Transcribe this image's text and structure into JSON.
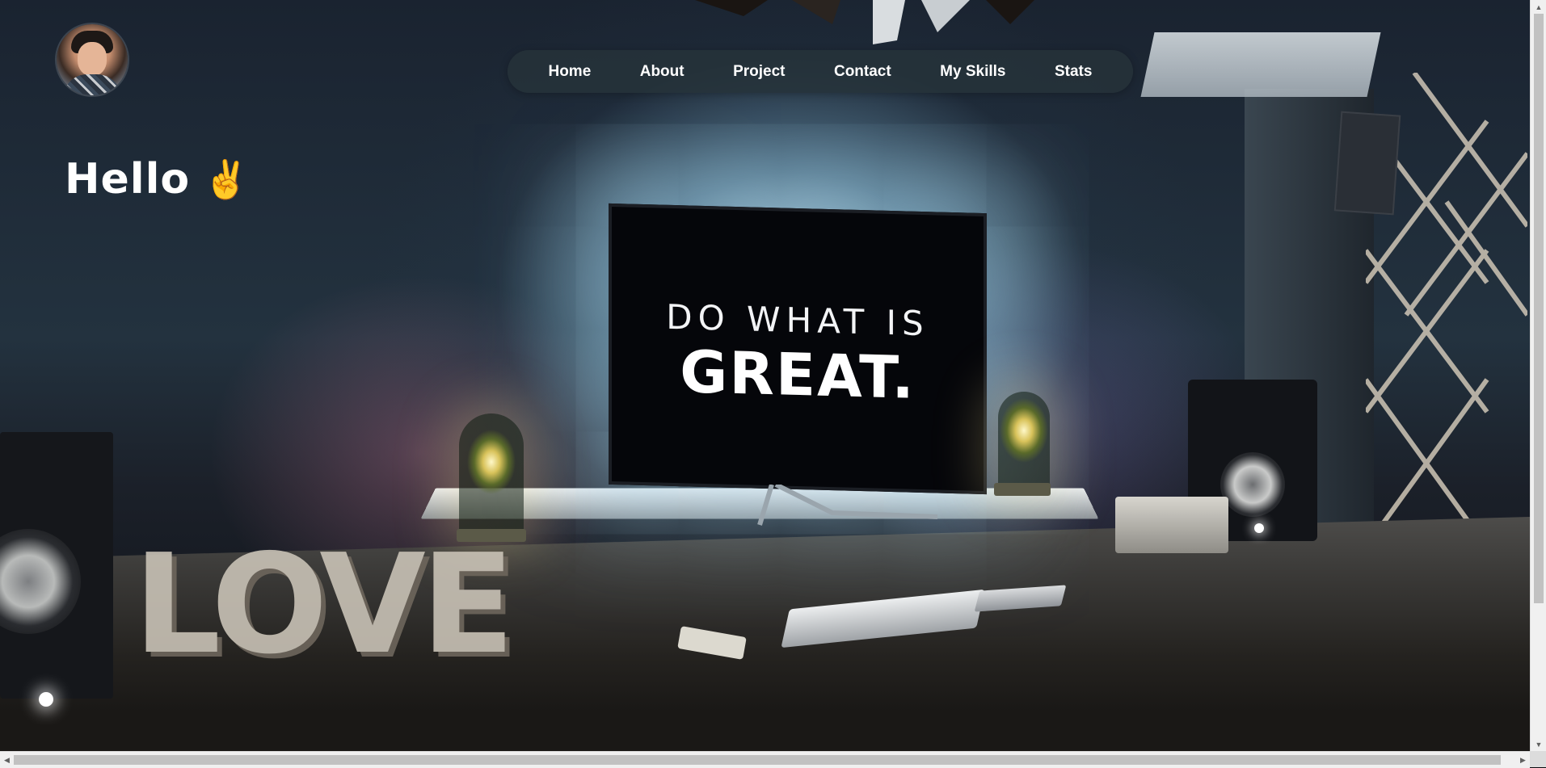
{
  "header": {
    "avatar_alt": "profile photo"
  },
  "nav": {
    "items": [
      {
        "label": "Home"
      },
      {
        "label": "About"
      },
      {
        "label": "Project"
      },
      {
        "label": "Contact"
      },
      {
        "label": "My Skills"
      },
      {
        "label": "Stats"
      }
    ]
  },
  "hero": {
    "greeting": "Hello",
    "greeting_emoji": "✌️",
    "background": {
      "monitor_line1": "DO WHAT IS",
      "monitor_line2": "GREAT.",
      "desk_sign": "LOVE"
    }
  },
  "colors": {
    "nav_bg": "#26323a",
    "nav_text": "#ffffff",
    "greeting_text": "#ffffff"
  },
  "icons": {
    "avatar": "avatar-icon",
    "greeting_emoji": "victory-hand-icon"
  }
}
